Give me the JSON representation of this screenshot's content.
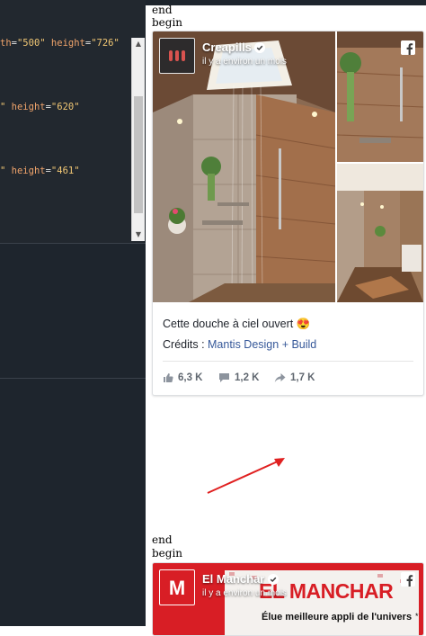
{
  "editor": {
    "lines": [
      {
        "attr1": "th",
        "str1": "\"500\"",
        "attr2": "height",
        "str2": "\"726\""
      },
      {
        "attr1": "",
        "str1": "\"",
        "attr2": "height",
        "str2": "\"620\""
      },
      {
        "attr1": "",
        "str1": "\"",
        "attr2": "height",
        "str2": "\"461\""
      }
    ]
  },
  "preview": {
    "marker_end_1": "end",
    "marker_begin_1": "begin",
    "marker_end_2": "end",
    "marker_begin_2": "begin"
  },
  "post1": {
    "page_name": "Creapills",
    "time": "il y a environ un mois",
    "text": "Cette douche à ciel ouvert",
    "emoji": "😍",
    "credits_label": "Crédits : ",
    "credits_link": "Mantis Design + Build",
    "likes": "6,3 K",
    "comments": "1,2 K",
    "shares": "1,7 K"
  },
  "post2": {
    "page_name": "El Manchar",
    "time": "il y a environ un mois",
    "banner_title": "EL MANCHAR",
    "banner_sub": "Élue meilleure appli de l'univers",
    "banner_mark": "*"
  },
  "colors": {
    "editor_bg": "#1e252d",
    "link": "#365899",
    "arrow": "#e02020",
    "brand_red": "#d81e25"
  }
}
